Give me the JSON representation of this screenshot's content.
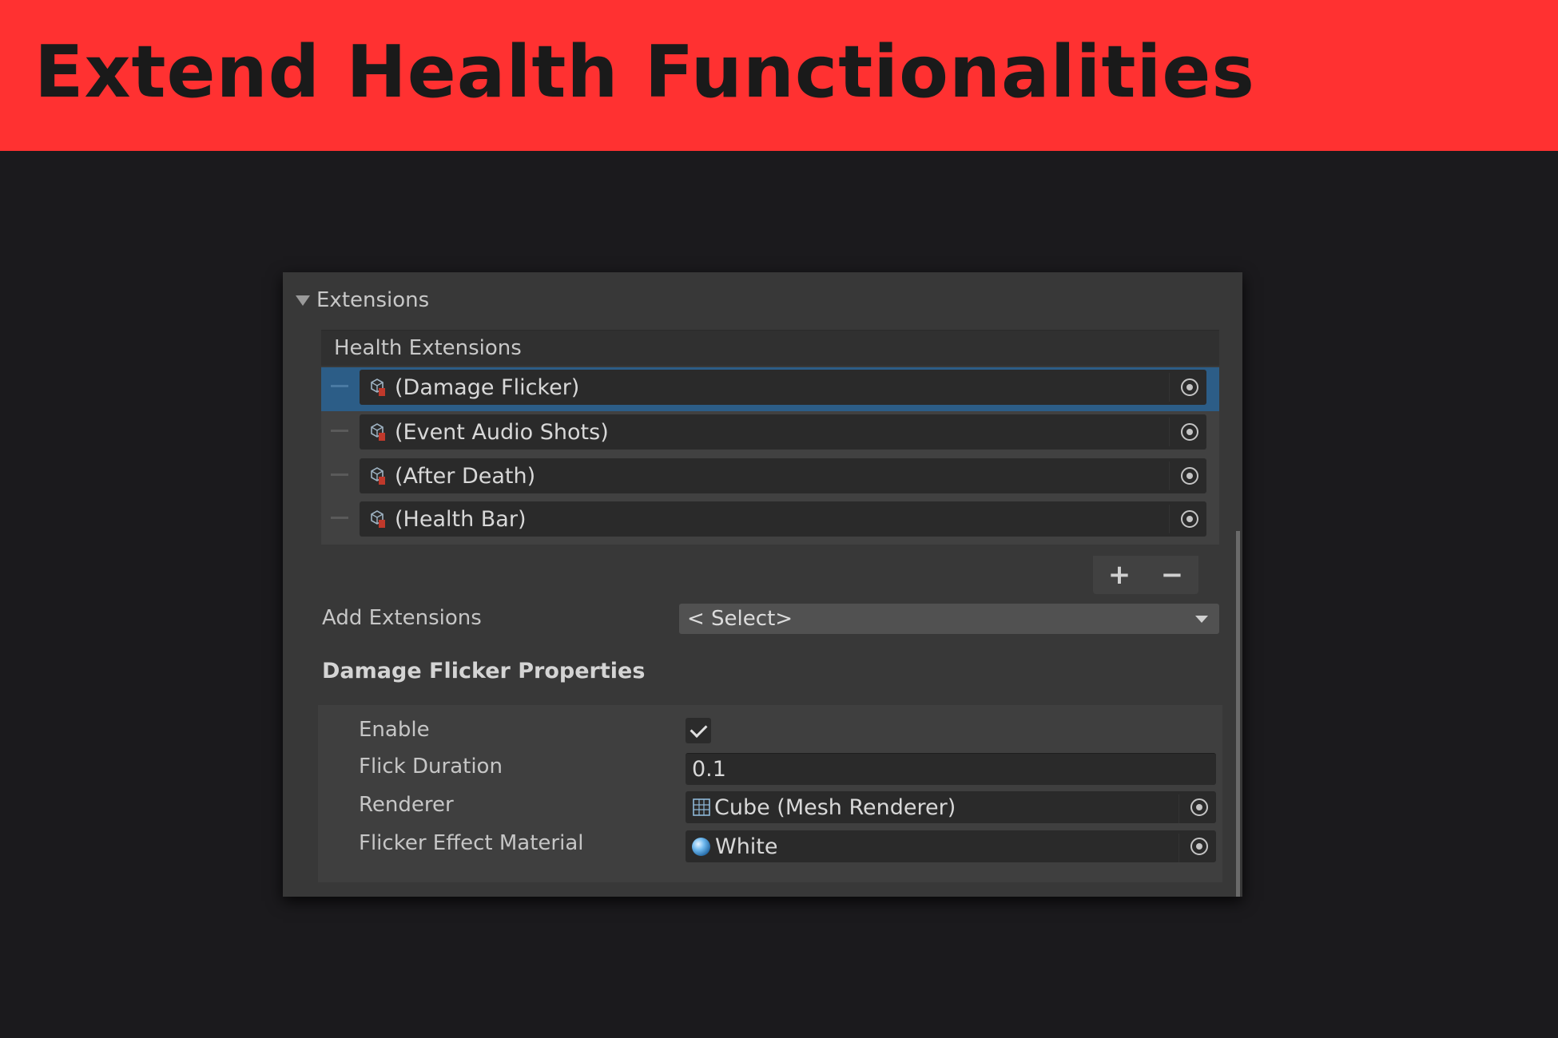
{
  "banner": {
    "title": "Extend Health Functionalities",
    "color": "#ff3131"
  },
  "inspector": {
    "foldout_label": "Extensions",
    "list": {
      "header": "Health Extensions",
      "items": [
        {
          "label": "(Damage Flicker)",
          "selected": true
        },
        {
          "label": "(Event Audio Shots)",
          "selected": false
        },
        {
          "label": "(After Death)",
          "selected": false
        },
        {
          "label": "(Health Bar)",
          "selected": false
        }
      ],
      "add_button": "+",
      "remove_button": "−"
    },
    "add_extensions": {
      "label": "Add Extensions",
      "selected": "< Select>"
    },
    "properties": {
      "title": "Damage Flicker Properties",
      "enable": {
        "label": "Enable",
        "checked": true
      },
      "flick_duration": {
        "label": "Flick Duration",
        "value": "0.1"
      },
      "renderer": {
        "label": "Renderer",
        "value": "Cube (Mesh Renderer)",
        "icon": "mesh-renderer-icon"
      },
      "flicker_material": {
        "label": "Flicker Effect Material",
        "value": "White",
        "icon": "material-sphere-icon"
      }
    },
    "colors": {
      "selection": "#2c5d87",
      "panel": "#383838"
    }
  }
}
